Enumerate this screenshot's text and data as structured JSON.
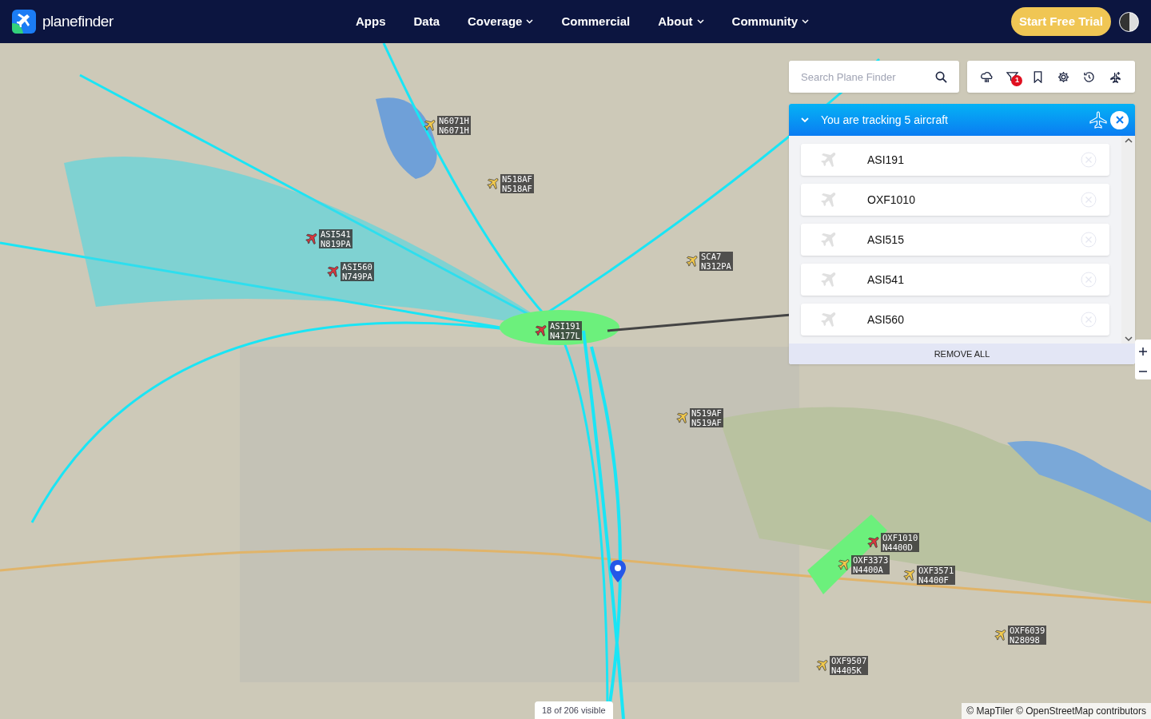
{
  "header": {
    "brand": "**plane**finder",
    "nav": [
      {
        "label": "Apps",
        "dropdown": false
      },
      {
        "label": "Data",
        "dropdown": false
      },
      {
        "label": "Coverage",
        "dropdown": true
      },
      {
        "label": "Commercial",
        "dropdown": false
      },
      {
        "label": "About",
        "dropdown": true
      },
      {
        "label": "Community",
        "dropdown": true
      }
    ],
    "cta": "Start Free Trial"
  },
  "search": {
    "placeholder": "Search Plane Finder"
  },
  "toolbar": {
    "filter_badge": "1"
  },
  "tracking": {
    "title": "You are tracking 5 aircraft",
    "items": [
      "ASI191",
      "OXF1010",
      "ASI515",
      "ASI541",
      "ASI560"
    ],
    "remove_all": "REMOVE ALL"
  },
  "aircraft": [
    {
      "callsign": "N6071H",
      "registration": "N6071H",
      "tracked": false
    },
    {
      "callsign": "N518AF",
      "registration": "N518AF",
      "tracked": false
    },
    {
      "callsign": "ASI541",
      "registration": "N819PA",
      "tracked": true
    },
    {
      "callsign": "ASI560",
      "registration": "N749PA",
      "tracked": true
    },
    {
      "callsign": "ASI191",
      "registration": "N4177L",
      "tracked": true
    },
    {
      "callsign": "SCA7",
      "registration": "N312PA",
      "tracked": false
    },
    {
      "callsign": "N519AF",
      "registration": "N519AF",
      "tracked": false
    },
    {
      "callsign": "OXF1010",
      "registration": "N4400D",
      "tracked": true
    },
    {
      "callsign": "OXF3373",
      "registration": "N4400A",
      "tracked": false
    },
    {
      "callsign": "OXF3571",
      "registration": "N4400F",
      "tracked": false
    },
    {
      "callsign": "OXF6039",
      "registration": "N28098",
      "tracked": false
    },
    {
      "callsign": "OXF9507",
      "registration": "N4405K",
      "tracked": false
    }
  ],
  "visible_count": "18 of 206 visible",
  "attribution": "© MapTiler © OpenStreetMap contributors"
}
